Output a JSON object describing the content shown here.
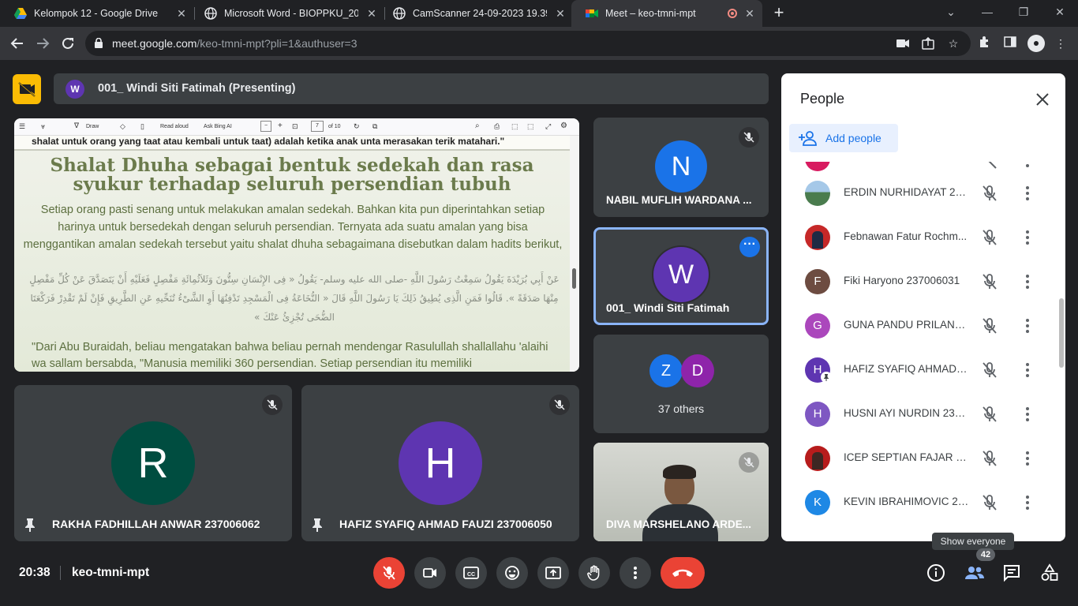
{
  "browser": {
    "tabs": [
      {
        "title": "Kelompok 12 - Google Drive",
        "close": "✕"
      },
      {
        "title": "Microsoft Word - BIOPPKU_2023",
        "close": "✕"
      },
      {
        "title": "CamScanner 24-09-2023 19.39",
        "close": "✕"
      },
      {
        "title": "Meet – keo-tmni-mpt",
        "close": "✕"
      }
    ],
    "new_tab": "+",
    "url_host": "meet.google.com",
    "url_path": "/keo-tmni-mpt?pli=1&authuser=3"
  },
  "meet": {
    "presenting_label": "001_ Windi Siti Fatimah (Presenting)",
    "presenter_initial": "W",
    "presentation": {
      "toolbar": {
        "draw": "Draw",
        "read_aloud": "Read aloud",
        "ask_bing": "Ask Bing AI",
        "page": "7",
        "of_pages": "of 10"
      },
      "cut_line": "shalat untuk orang yang taat atau kembali untuk taat) adalah ketika anak unta merasakan terik matahari.\"",
      "title": "Shalat Dhuha sebagai bentuk sedekah dan rasa syukur terhadap seluruh persendian tubuh",
      "body": "Setiap orang pasti senang untuk melakukan amalan sedekah. Bahkan kita pun diperintahkan setiap harinya untuk bersedekah dengan seluruh persendian. Ternyata ada suatu amalan yang bisa menggantikan amalan sedekah tersebut yaitu shalat dhuha sebagaimana disebutkan  dalam hadits berikut,",
      "arabic": "عَنْ أَبِي بُرَيْدَةَ يَقُولُ سَمِعْتُ رَسُولَ اللَّهِ -صلى الله عليه وسلم- يَقُولُ « فِى الإِنْسَانِ سِتُّونَ وَثَلاَثُمِائَةِ مَفْصِلٍ فَعَلَيْهِ أَنْ يَتَصَدَّقَ عَنْ كُلِّ مَفْصِلٍ مِنْهَا صَدَقَةً ». قَالُوا فَمَنِ الَّذِى يُطِيقُ ذَلِكَ يَا رَسُولَ اللَّهِ قَالَ « النُّخَاعَةُ فِى الْمَسْجِدِ تَدْفِنُهَا أَوِ الشَّىْءُ تُنَحِّيهِ عَنِ الطَّرِيقِ فَإِنْ لَمْ تَقْدِرْ فَرَكْعَتَا الضُّحَى تُجْزِئُ عَنْكَ »",
      "quote": "\"Dari Abu Buraidah, beliau mengatakan bahwa beliau pernah mendengar Rasulullah shallallahu 'alaihi wa sallam bersabda, \"Manusia memiliki 360 persendian. Setiap persendian itu memiliki"
    },
    "tiles": [
      {
        "id": "nabil",
        "initial": "N",
        "name": "NABIL MUFLIH WARDANA ...",
        "color": "#1a73e8"
      },
      {
        "id": "windi",
        "initial": "W",
        "name": "001_ Windi Siti Fatimah",
        "color": "#5e35b1"
      },
      {
        "id": "others",
        "label": "37 others",
        "initials": [
          "Z",
          "D"
        ],
        "colors": [
          "#1a73e8",
          "#8e24aa"
        ]
      },
      {
        "id": "diva",
        "name": "DIVA MARSHELANO ARDE..."
      },
      {
        "id": "rakha",
        "initial": "R",
        "name": "RAKHA FADHILLAH ANWAR 237006062",
        "color": "#004d40"
      },
      {
        "id": "hafiz",
        "initial": "H",
        "name": "HAFIZ SYAFIQ AHMAD FAUZI 237006050",
        "color": "#5e35b1"
      }
    ],
    "people_panel": {
      "title": "People",
      "add_people": "Add people",
      "participants": [
        {
          "name": "ERDIN NURHIDAYAT 237...",
          "initial": "",
          "color": "#4a7c4e",
          "photo": true
        },
        {
          "name": "Febnawan Fatur Rochm...",
          "initial": "",
          "color": "#c62828",
          "photo": true
        },
        {
          "name": "Fiki Haryono 237006031",
          "initial": "F",
          "color": "#6d4c41"
        },
        {
          "name": "GUNA PANDU PRILANA ...",
          "initial": "G",
          "color": "#ab47bc"
        },
        {
          "name": "HAFIZ SYAFIQ AHMAD F...",
          "initial": "H",
          "color": "#5e35b1"
        },
        {
          "name": "HUSNI AYI NURDIN 2370...",
          "initial": "H",
          "color": "#7e57c2"
        },
        {
          "name": "ICEP SEPTIAN FAJAR 23...",
          "initial": "",
          "color": "#b71c1c",
          "photo": true
        },
        {
          "name": "KEVIN IBRAHIMOVIC 23...",
          "initial": "K",
          "color": "#1e88e5"
        }
      ]
    },
    "tooltip": "Show everyone",
    "participant_count": "42",
    "time": "20:38",
    "meeting_code": "keo-tmni-mpt"
  },
  "colors": {
    "accent": "#1a73e8",
    "danger": "#ea4335",
    "surface": "#3c4043",
    "background": "#202124"
  }
}
